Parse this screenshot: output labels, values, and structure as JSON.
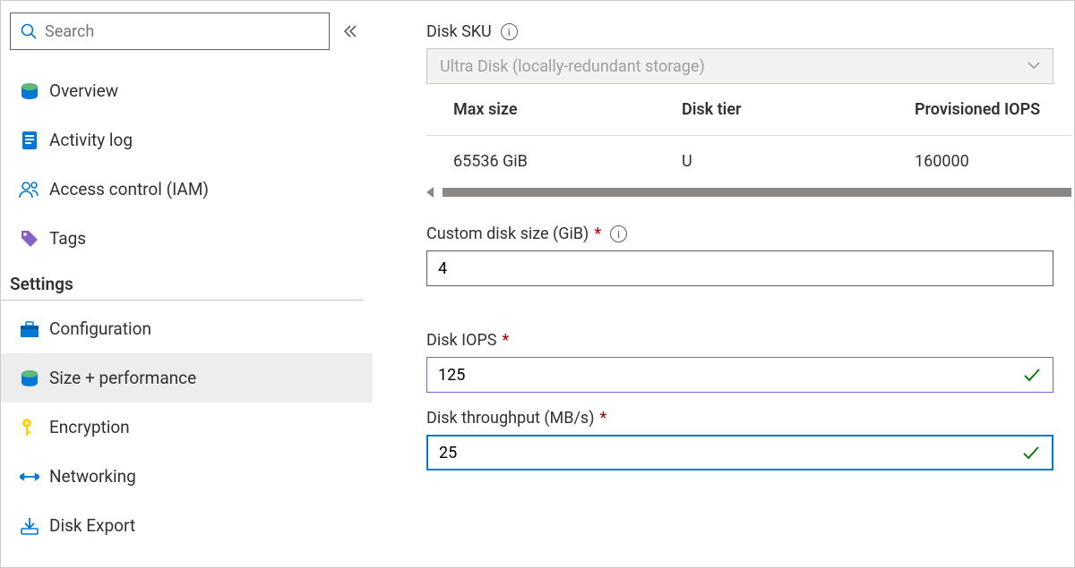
{
  "search": {
    "placeholder": "Search"
  },
  "sidebar": {
    "items": [
      {
        "label": "Overview"
      },
      {
        "label": "Activity log"
      },
      {
        "label": "Access control (IAM)"
      },
      {
        "label": "Tags"
      }
    ],
    "section_label": "Settings",
    "settings_items": [
      {
        "label": "Configuration"
      },
      {
        "label": "Size + performance"
      },
      {
        "label": "Encryption"
      },
      {
        "label": "Networking"
      },
      {
        "label": "Disk Export"
      }
    ]
  },
  "main": {
    "disk_sku_label": "Disk SKU",
    "disk_sku_value": "Ultra Disk (locally-redundant storage)",
    "table": {
      "col_size": "Max size",
      "col_tier": "Disk tier",
      "col_iops": "Provisioned IOPS",
      "row": {
        "size": "65536 GiB",
        "tier": "U",
        "iops": "160000"
      }
    },
    "custom_size_label": "Custom disk size (GiB)",
    "custom_size_value": "4",
    "disk_iops_label": "Disk IOPS",
    "disk_iops_value": "125",
    "throughput_label": "Disk throughput (MB/s)",
    "throughput_value": "25"
  }
}
